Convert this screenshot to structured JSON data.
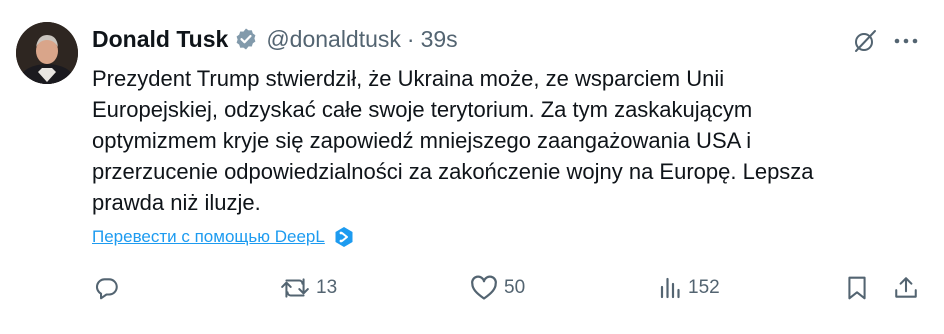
{
  "author": {
    "name": "Donald Tusk",
    "handle": "@donaldtusk",
    "separator": "·",
    "time": "39s",
    "verified_color": "#829aab"
  },
  "post": {
    "text": "Prezydent Trump stwierdził, że Ukraina może, ze wsparciem Unii\nEuropejskiej, odzyskać całe swoje terytorium. Za tym zaskakującym\noptymizmem kryje się zapowiedź mniejszego zaangażowania USA i\nprzerzucenie odpowiedzialności za zakończenie wojny na Europę. Lepsza\nprawda niż iluzje."
  },
  "translate": {
    "label": "Перевести с помощью DeepL",
    "icon": "deepl-icon",
    "color": "#1d9bf0"
  },
  "actions": {
    "reply": {
      "icon": "reply-icon",
      "count": ""
    },
    "retweet": {
      "icon": "retweet-icon",
      "count": "13"
    },
    "like": {
      "icon": "heart-icon",
      "count": "50"
    },
    "views": {
      "icon": "views-icon",
      "count": "152"
    },
    "bookmark": {
      "icon": "bookmark-icon"
    },
    "share": {
      "icon": "share-icon"
    }
  },
  "top_controls": {
    "grok": {
      "icon": "grok-icon"
    },
    "more": {
      "icon": "more-icon"
    }
  }
}
